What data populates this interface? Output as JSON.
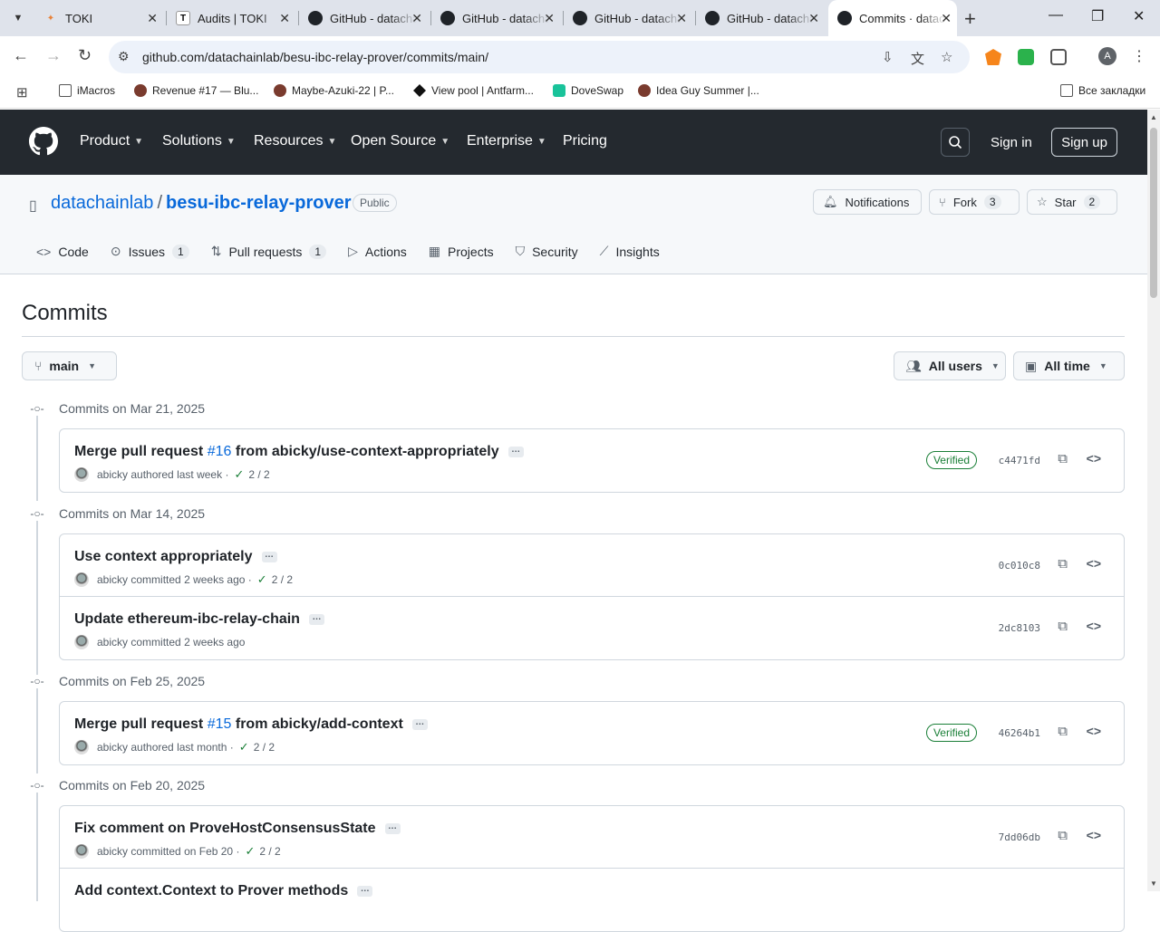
{
  "browser": {
    "tabs": [
      {
        "title": "TOKI",
        "active": false
      },
      {
        "title": "Audits | TOKI",
        "active": false
      },
      {
        "title": "GitHub - datachainlab",
        "active": false
      },
      {
        "title": "GitHub - datachainlab",
        "active": false
      },
      {
        "title": "GitHub - datachainlab",
        "active": false
      },
      {
        "title": "GitHub - datachainlab",
        "active": false
      },
      {
        "title": "Commits · datachainlab",
        "active": true
      }
    ],
    "url": "github.com/datachainlab/besu-ibc-relay-prover/commits/main/",
    "profile_initial": "A",
    "bookmarks": [
      "iMacros",
      "Revenue #17 — Blu...",
      "Maybe-Azuki-22 | P...",
      "View pool | Antfarm...",
      "DoveSwap",
      "Idea Guy Summer |...",
      "Все закладки"
    ]
  },
  "gh_header": {
    "nav": [
      "Product",
      "Solutions",
      "Resources",
      "Open Source",
      "Enterprise",
      "Pricing"
    ],
    "sign_in": "Sign in",
    "sign_up": "Sign up"
  },
  "repo": {
    "owner": "datachainlab",
    "name": "besu-ibc-relay-prover",
    "visibility": "Public",
    "notifications": "Notifications",
    "fork_label": "Fork",
    "fork_count": "3",
    "star_label": "Star",
    "star_count": "2",
    "tabs": {
      "code": "Code",
      "issues": "Issues",
      "issues_count": "1",
      "pulls": "Pull requests",
      "pulls_count": "1",
      "actions": "Actions",
      "projects": "Projects",
      "security": "Security",
      "insights": "Insights"
    }
  },
  "commits_page": {
    "title": "Commits",
    "branch": "main",
    "users_filter": "All users",
    "time_filter": "All time",
    "groups": [
      {
        "date": "Commits on Mar 21, 2025",
        "commits": [
          {
            "msg_pre": "Merge pull request ",
            "pr": "#16",
            "msg_post": " from abicky/use-context-appropriately",
            "author": "abicky",
            "action": "authored",
            "when": "last week",
            "checks": "2 / 2",
            "verified": "Verified",
            "sha": "c4471fd"
          }
        ]
      },
      {
        "date": "Commits on Mar 14, 2025",
        "commits": [
          {
            "msg": "Use context appropriately",
            "author": "abicky",
            "action": "committed",
            "when": "2 weeks ago",
            "checks": "2 / 2",
            "sha": "0c010c8"
          },
          {
            "msg": "Update ethereum-ibc-relay-chain",
            "author": "abicky",
            "action": "committed",
            "when": "2 weeks ago",
            "sha": "2dc8103"
          }
        ]
      },
      {
        "date": "Commits on Feb 25, 2025",
        "commits": [
          {
            "msg_pre": "Merge pull request ",
            "pr": "#15",
            "msg_post": " from abicky/add-context",
            "author": "abicky",
            "action": "authored",
            "when": "last month",
            "checks": "2 / 2",
            "verified": "Verified",
            "sha": "46264b1"
          }
        ]
      },
      {
        "date": "Commits on Feb 20, 2025",
        "commits": [
          {
            "msg": "Fix comment on ProveHostConsensusState",
            "author": "abicky",
            "action": "committed",
            "when": "on Feb 20",
            "checks": "2 / 2",
            "sha": "7dd06db"
          },
          {
            "msg": "Add context.Context to Prover methods"
          }
        ]
      }
    ]
  },
  "colors": {
    "accent": "#0969da",
    "header_bg": "#24292f",
    "verified": "#1a7f37"
  }
}
